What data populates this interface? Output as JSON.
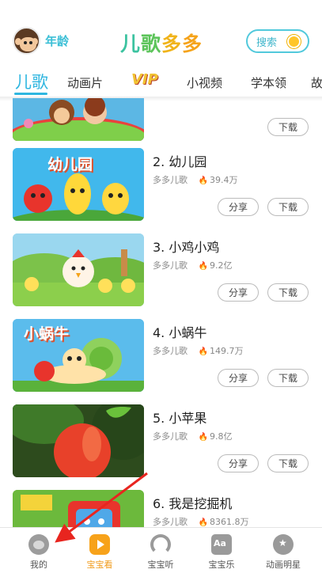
{
  "header": {
    "age_label": "年龄",
    "logo_chars": [
      "儿",
      "歌",
      "多",
      "多"
    ],
    "search_label": "搜索"
  },
  "tabs": [
    {
      "label": "儿歌",
      "active": true
    },
    {
      "label": "动画片"
    },
    {
      "label": "VIP"
    },
    {
      "label": "小视频"
    },
    {
      "label": "学本领"
    },
    {
      "label": "故"
    }
  ],
  "songs": [
    {
      "title": "",
      "channel": "",
      "plays": "",
      "share_label": "",
      "download_label": "下载"
    },
    {
      "title": "2. 幼儿园",
      "channel": "多多儿歌",
      "plays": "39.4万",
      "share_label": "分享",
      "download_label": "下载",
      "thumb_text": "幼儿园"
    },
    {
      "title": "3. 小鸡小鸡",
      "channel": "多多儿歌",
      "plays": "9.2亿",
      "share_label": "分享",
      "download_label": "下载"
    },
    {
      "title": "4. 小蜗牛",
      "channel": "多多儿歌",
      "plays": "149.7万",
      "share_label": "分享",
      "download_label": "下载",
      "thumb_text": "小蜗牛"
    },
    {
      "title": "5. 小苹果",
      "channel": "多多儿歌",
      "plays": "9.8亿",
      "share_label": "分享",
      "download_label": "下载"
    },
    {
      "title": "6. 我是挖掘机",
      "channel": "多多儿歌",
      "plays": "8361.8万",
      "share_label": "",
      "download_label": ""
    }
  ],
  "bottom_nav": [
    {
      "label": "我的",
      "icon": "monkey-icon"
    },
    {
      "label": "宝宝看",
      "icon": "tv-icon",
      "active": true
    },
    {
      "label": "宝宝听",
      "icon": "headphones-icon"
    },
    {
      "label": "宝宝乐",
      "icon": "abc-icon"
    },
    {
      "label": "动画明星",
      "icon": "star-bear-icon"
    }
  ],
  "colors": {
    "accent": "#2fb6e0",
    "active_nav": "#f09a1a"
  }
}
